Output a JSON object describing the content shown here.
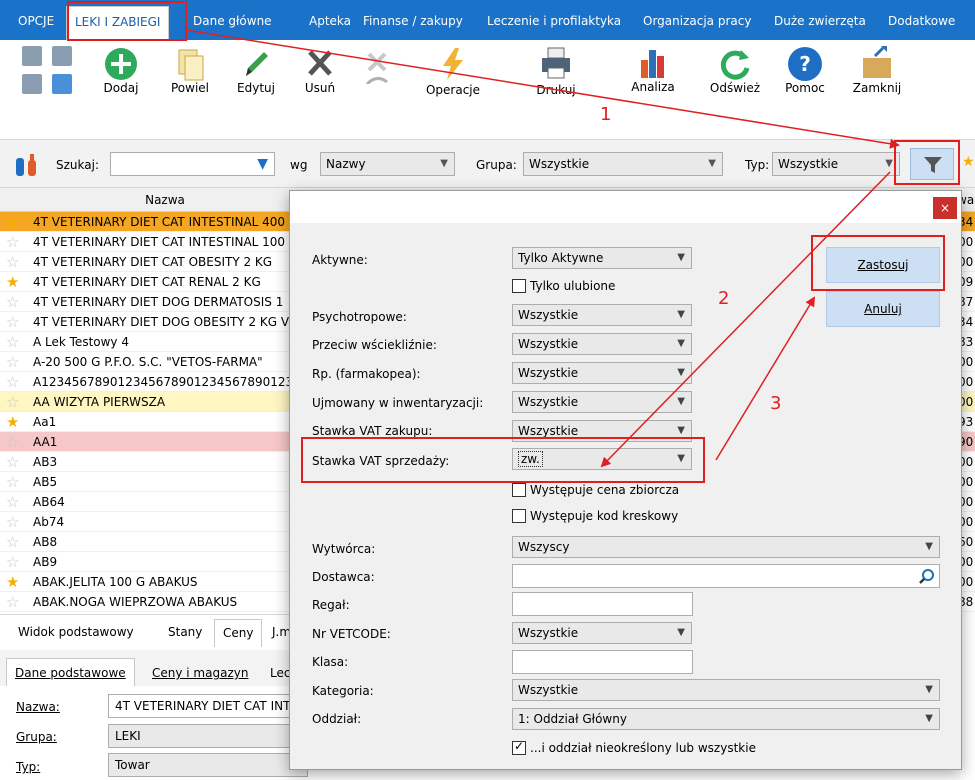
{
  "menu": {
    "tabs": [
      "OPCJE",
      "LEKI I ZABIEGI",
      "Dane główne",
      "Apteka",
      "Finanse / zakupy",
      "Leczenie i profilaktyka",
      "Organizacja pracy",
      "Duże zwierzęta",
      "Dodatkowe"
    ],
    "active": "LEKI I ZABIEGI"
  },
  "ribbon": {
    "buttons": [
      "Dodaj",
      "Powiel",
      "Edytuj",
      "Usuń",
      "Operacje",
      "Drukuj",
      "Analiza",
      "Odśwież",
      "Pomoc",
      "Zamknij"
    ]
  },
  "searchbar": {
    "search_label": "Szukaj:",
    "search_value": "",
    "wg_label": "wg",
    "wg_value": "Nazwy",
    "group_label": "Grupa:",
    "group_value": "Wszystkie",
    "type_label": "Typ:",
    "type_value": "Wszystkie"
  },
  "list": {
    "header_name": "Nazwa",
    "header_right": "wa",
    "rows": [
      {
        "name": "4T VETERINARY DIET CAT INTESTINAL 400",
        "right": "34",
        "fav": true,
        "style": "sel"
      },
      {
        "name": "4T VETERINARY DIET CAT INTESTINAL 100",
        "right": "00",
        "fav": false,
        "style": ""
      },
      {
        "name": "4T VETERINARY DIET CAT OBESITY 2 KG",
        "right": "00",
        "fav": false,
        "style": ""
      },
      {
        "name": "4T VETERINARY DIET CAT RENAL 2 KG",
        "right": "09",
        "fav": true,
        "style": ""
      },
      {
        "name": "4T VETERINARY DIET DOG DERMATOSIS 1",
        "right": "87",
        "fav": false,
        "style": ""
      },
      {
        "name": "4T VETERINARY DIET DOG OBESITY 2 KG V",
        "right": "34",
        "fav": false,
        "style": ""
      },
      {
        "name": "A Lek Testowy 4",
        "right": "83",
        "fav": false,
        "style": ""
      },
      {
        "name": "A-20 500 G    P.F.O. S.C. \"VETOS-FARMA\"",
        "right": "00",
        "fav": false,
        "style": ""
      },
      {
        "name": "A123456789012345678901234567890123",
        "right": "00",
        "fav": false,
        "style": ""
      },
      {
        "name": "AA WIZYTA PIERWSZA",
        "right": "00",
        "fav": false,
        "style": "hl"
      },
      {
        "name": "Aa1",
        "right": "93",
        "fav": true,
        "style": ""
      },
      {
        "name": "AA1",
        "right": "90",
        "fav": false,
        "style": "red"
      },
      {
        "name": "AB3",
        "right": "00",
        "fav": false,
        "style": ""
      },
      {
        "name": "AB5",
        "right": "00",
        "fav": false,
        "style": ""
      },
      {
        "name": "AB64",
        "right": "00",
        "fav": false,
        "style": ""
      },
      {
        "name": "Ab74",
        "right": "00",
        "fav": false,
        "style": ""
      },
      {
        "name": "AB8",
        "right": "60",
        "fav": false,
        "style": ""
      },
      {
        "name": "AB9",
        "right": "00",
        "fav": false,
        "style": ""
      },
      {
        "name": "ABAK.JELITA 100 G    ABAKUS",
        "right": "00",
        "fav": true,
        "style": ""
      },
      {
        "name": "ABAK.NOGA WIEPRZOWA    ABAKUS",
        "right": "88",
        "fav": false,
        "style": ""
      }
    ]
  },
  "tabs_row1": [
    "Widok podstawowy",
    "Stany",
    "Ceny",
    "J.m"
  ],
  "tabs_row2": [
    "Dane podstawowe",
    "Ceny i magazyn",
    "Lec"
  ],
  "details": {
    "nazwa_label": "Nazwa:",
    "nazwa_value": "4T VETERINARY DIET CAT INT",
    "grupa_label": "Grupa:",
    "grupa_value": "LEKI",
    "typ_label": "Typ:",
    "typ_value": "Towar"
  },
  "dialog": {
    "close": "×",
    "fields": {
      "aktywne": {
        "label": "Aktywne:",
        "value": "Tylko Aktywne"
      },
      "tylko_ulubione": "Tylko ulubione",
      "psychotropowe": {
        "label": "Psychotropowe:",
        "value": "Wszystkie"
      },
      "wscieklizna": {
        "label": "Przeciw wściekliźnie:",
        "value": "Wszystkie"
      },
      "rp": {
        "label": "Rp. (farmakopea):",
        "value": "Wszystkie"
      },
      "inwentaryzacja": {
        "label": "Ujmowany w inwentaryzacji:",
        "value": "Wszystkie"
      },
      "vat_zakupu": {
        "label": "Stawka VAT zakupu:",
        "value": "Wszystkie"
      },
      "vat_sprzedazy": {
        "label": "Stawka VAT sprzedaży:",
        "value": "zw."
      },
      "cena_zbiorcza": "Występuje cena zbiorcza",
      "kod_kreskowy": "Występuje kod kreskowy",
      "wytworca": {
        "label": "Wytwórca:",
        "value": "Wszyscy"
      },
      "dostawca": {
        "label": "Dostawca:",
        "value": ""
      },
      "regal": {
        "label": "Regał:",
        "value": ""
      },
      "vetcode": {
        "label": "Nr VETCODE:",
        "value": "Wszystkie"
      },
      "klasa": {
        "label": "Klasa:",
        "value": ""
      },
      "kategoria": {
        "label": "Kategoria:",
        "value": "Wszystkie"
      },
      "oddzial": {
        "label": "Oddział:",
        "value": "1: Oddział Główny"
      },
      "oddzial_chk": "...i oddział nieokreślony lub wszystkie"
    },
    "apply": "Zastosuj",
    "cancel": "Anuluj"
  },
  "annotations": {
    "n1": "1",
    "n2": "2",
    "n3": "3"
  },
  "colors": {
    "menu": "#1a73c8",
    "annotation": "#e02020",
    "selected_row": "#f5a623",
    "button": "#cde0f3"
  }
}
